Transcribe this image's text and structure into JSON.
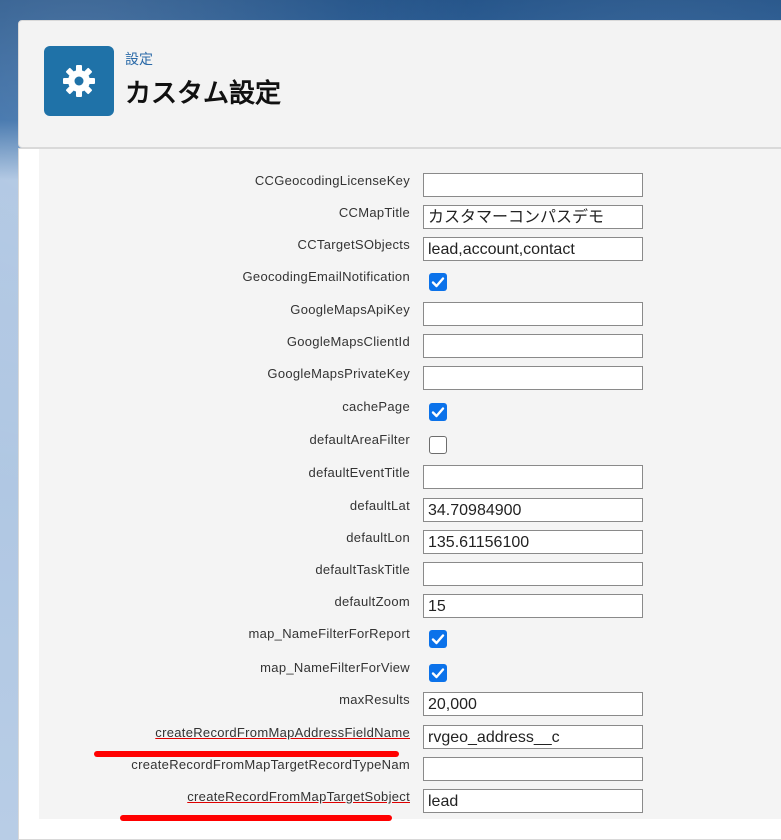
{
  "header": {
    "breadcrumb": "設定",
    "title": "カスタム設定",
    "icon": "gear-icon",
    "accent_color": "#1f72a8"
  },
  "settings": [
    {
      "label": "CCGeocodingLicenseKey",
      "type": "text",
      "value": ""
    },
    {
      "label": "CCMapTitle",
      "type": "text",
      "value": "カスタマーコンパスデモ"
    },
    {
      "label": "CCTargetSObjects",
      "type": "text",
      "value": "lead,account,contact"
    },
    {
      "label": "GeocodingEmailNotification",
      "type": "checkbox",
      "checked": true
    },
    {
      "label": "GoogleMapsApiKey",
      "type": "text",
      "value": ""
    },
    {
      "label": "GoogleMapsClientId",
      "type": "text",
      "value": ""
    },
    {
      "label": "GoogleMapsPrivateKey",
      "type": "text",
      "value": ""
    },
    {
      "label": "cachePage",
      "type": "checkbox",
      "checked": true
    },
    {
      "label": "defaultAreaFilter",
      "type": "checkbox",
      "checked": false
    },
    {
      "label": "defaultEventTitle",
      "type": "text",
      "value": ""
    },
    {
      "label": "defaultLat",
      "type": "text",
      "value": "34.70984900"
    },
    {
      "label": "defaultLon",
      "type": "text",
      "value": "135.61156100"
    },
    {
      "label": "defaultTaskTitle",
      "type": "text",
      "value": ""
    },
    {
      "label": "defaultZoom",
      "type": "text",
      "value": "15"
    },
    {
      "label": "map_NameFilterForReport",
      "type": "checkbox",
      "checked": true
    },
    {
      "label": "map_NameFilterForView",
      "type": "checkbox",
      "checked": true
    },
    {
      "label": "maxResults",
      "type": "text",
      "value": "20,000"
    },
    {
      "label": "createRecordFromMapAddressFieldName",
      "type": "text",
      "value": "rvgeo_address__c",
      "highlighted": true
    },
    {
      "label": "createRecordFromMapTargetRecordTypeNam",
      "type": "text",
      "value": ""
    },
    {
      "label": "createRecordFromMapTargetSobject",
      "type": "text",
      "value": "lead",
      "highlighted": true
    }
  ],
  "colors": {
    "checkbox_checked": "#0b72ea",
    "highlight_underline": "#ff0000"
  }
}
